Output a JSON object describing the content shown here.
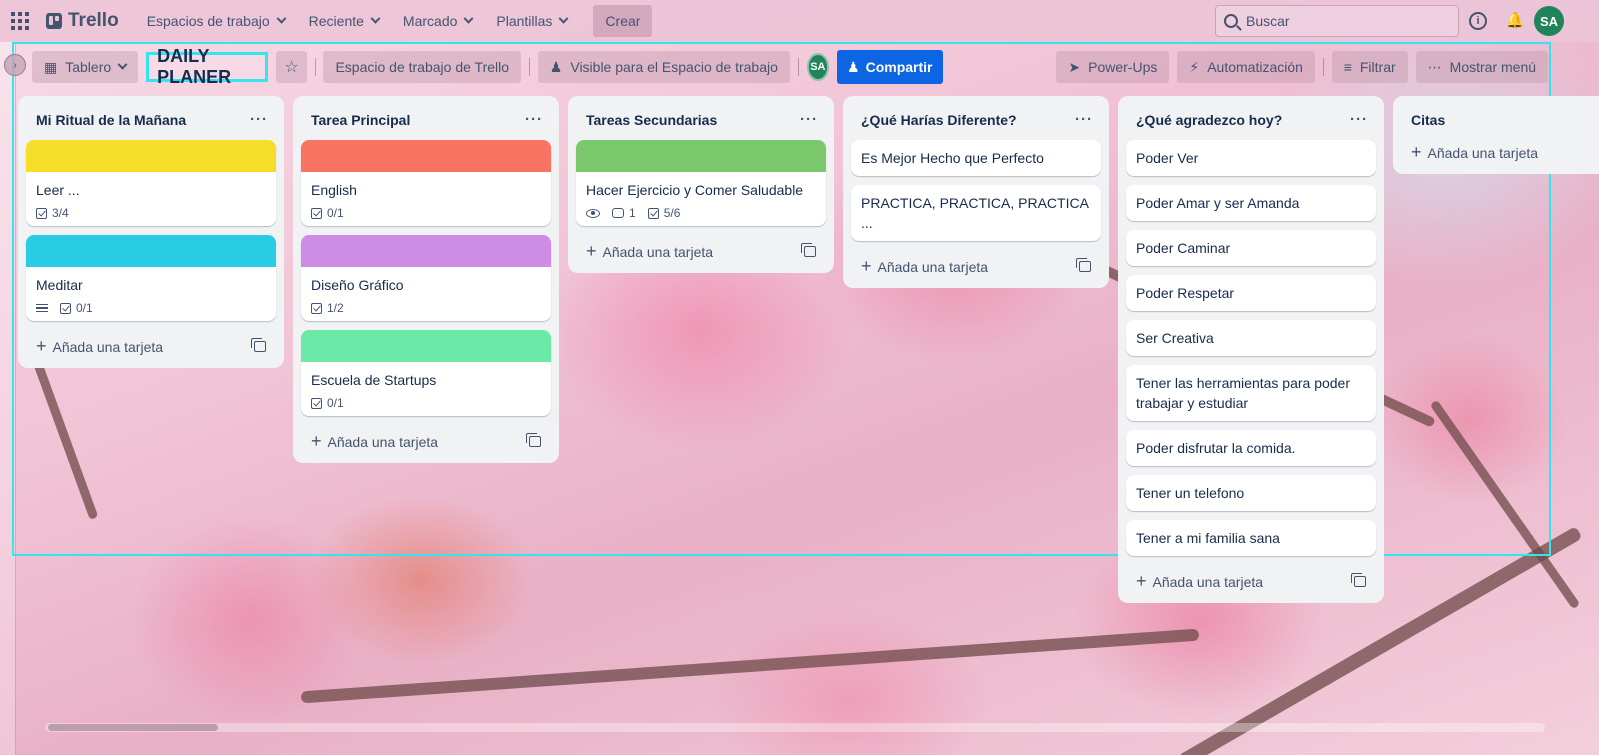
{
  "header": {
    "brand": "Trello",
    "nav": [
      {
        "label": "Espacios de trabajo"
      },
      {
        "label": "Reciente"
      },
      {
        "label": "Marcado"
      },
      {
        "label": "Plantillas"
      }
    ],
    "create_label": "Crear",
    "search_placeholder": "Buscar",
    "avatar_initials": "SA",
    "info_glyph": "i"
  },
  "board": {
    "view_label": "Tablero",
    "title": "DAILY PLANER",
    "workspace_label": "Espacio de trabajo de Trello",
    "visibility_label": "Visible para el Espacio de trabajo",
    "member_initials": "SA",
    "share_label": "Compartir",
    "powerups_label": "Power-Ups",
    "automation_label": "Automatización",
    "filter_label": "Filtrar",
    "menu_label": "Mostrar menú"
  },
  "add_card_label": "Añada una tarjeta",
  "lists": [
    {
      "title": "Mi Ritual de la Mañana",
      "cards": [
        {
          "title": "Leer ...",
          "cover": "#f5dd29",
          "checklist": "3/4"
        },
        {
          "title": "Meditar",
          "cover": "#29cce5",
          "checklist": "0/1",
          "description": true
        }
      ]
    },
    {
      "title": "Tarea Principal",
      "cards": [
        {
          "title": "English",
          "cover": "#f87462",
          "checklist": "0/1"
        },
        {
          "title": "Diseño Gráfico",
          "cover": "#cd8de5",
          "checklist": "1/2"
        },
        {
          "title": "Escuela de Startups",
          "cover": "#6be9a6",
          "checklist": "0/1"
        }
      ]
    },
    {
      "title": "Tareas Secundarias",
      "cards": [
        {
          "title": "Hacer Ejercicio y Comer Saludable",
          "cover": "#7bc86c",
          "comments": "1",
          "checklist": "5/6",
          "watching": true
        }
      ]
    },
    {
      "title": "¿Qué Harías Diferente?",
      "cards": [
        {
          "title": "Es Mejor Hecho que Perfecto"
        },
        {
          "title": "PRACTICA, PRACTICA, PRACTICA ..."
        }
      ]
    },
    {
      "title": "¿Qué agradezco hoy?",
      "cards": [
        {
          "title": "Poder Ver"
        },
        {
          "title": "Poder Amar y ser Amanda"
        },
        {
          "title": "Poder Caminar"
        },
        {
          "title": "Poder Respetar"
        },
        {
          "title": "Ser Creativa"
        },
        {
          "title": "Tener las herramientas para poder trabajar y estudiar"
        },
        {
          "title": "Poder disfrutar la comida."
        },
        {
          "title": "Tener un telefono"
        },
        {
          "title": "Tener a mi familia sana"
        }
      ]
    },
    {
      "title": "Citas",
      "cards": []
    }
  ]
}
